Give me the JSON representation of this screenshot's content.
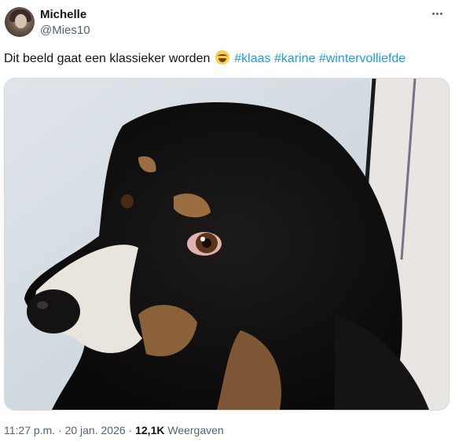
{
  "author": {
    "name": "Michelle",
    "handle": "@Mies10",
    "avatar_icon": "profile-photo"
  },
  "more_icon": "ellipsis-icon",
  "tweet": {
    "text": "Dit beeld gaat een klassieker worden",
    "emoji": "face-with-tears-of-joy",
    "hashtags": [
      "#klaas",
      "#karine",
      "#wintervolliefde"
    ]
  },
  "media": {
    "description_icon": "dog-photo"
  },
  "meta": {
    "time": "11:27 p.m.",
    "separator": "·",
    "date": "20 jan. 2026",
    "views_count": "12,1K",
    "views_label": "Weergaven"
  },
  "colors": {
    "link": "#1d9bf0",
    "secondary_text": "#536471",
    "primary_text": "#0f1419"
  }
}
